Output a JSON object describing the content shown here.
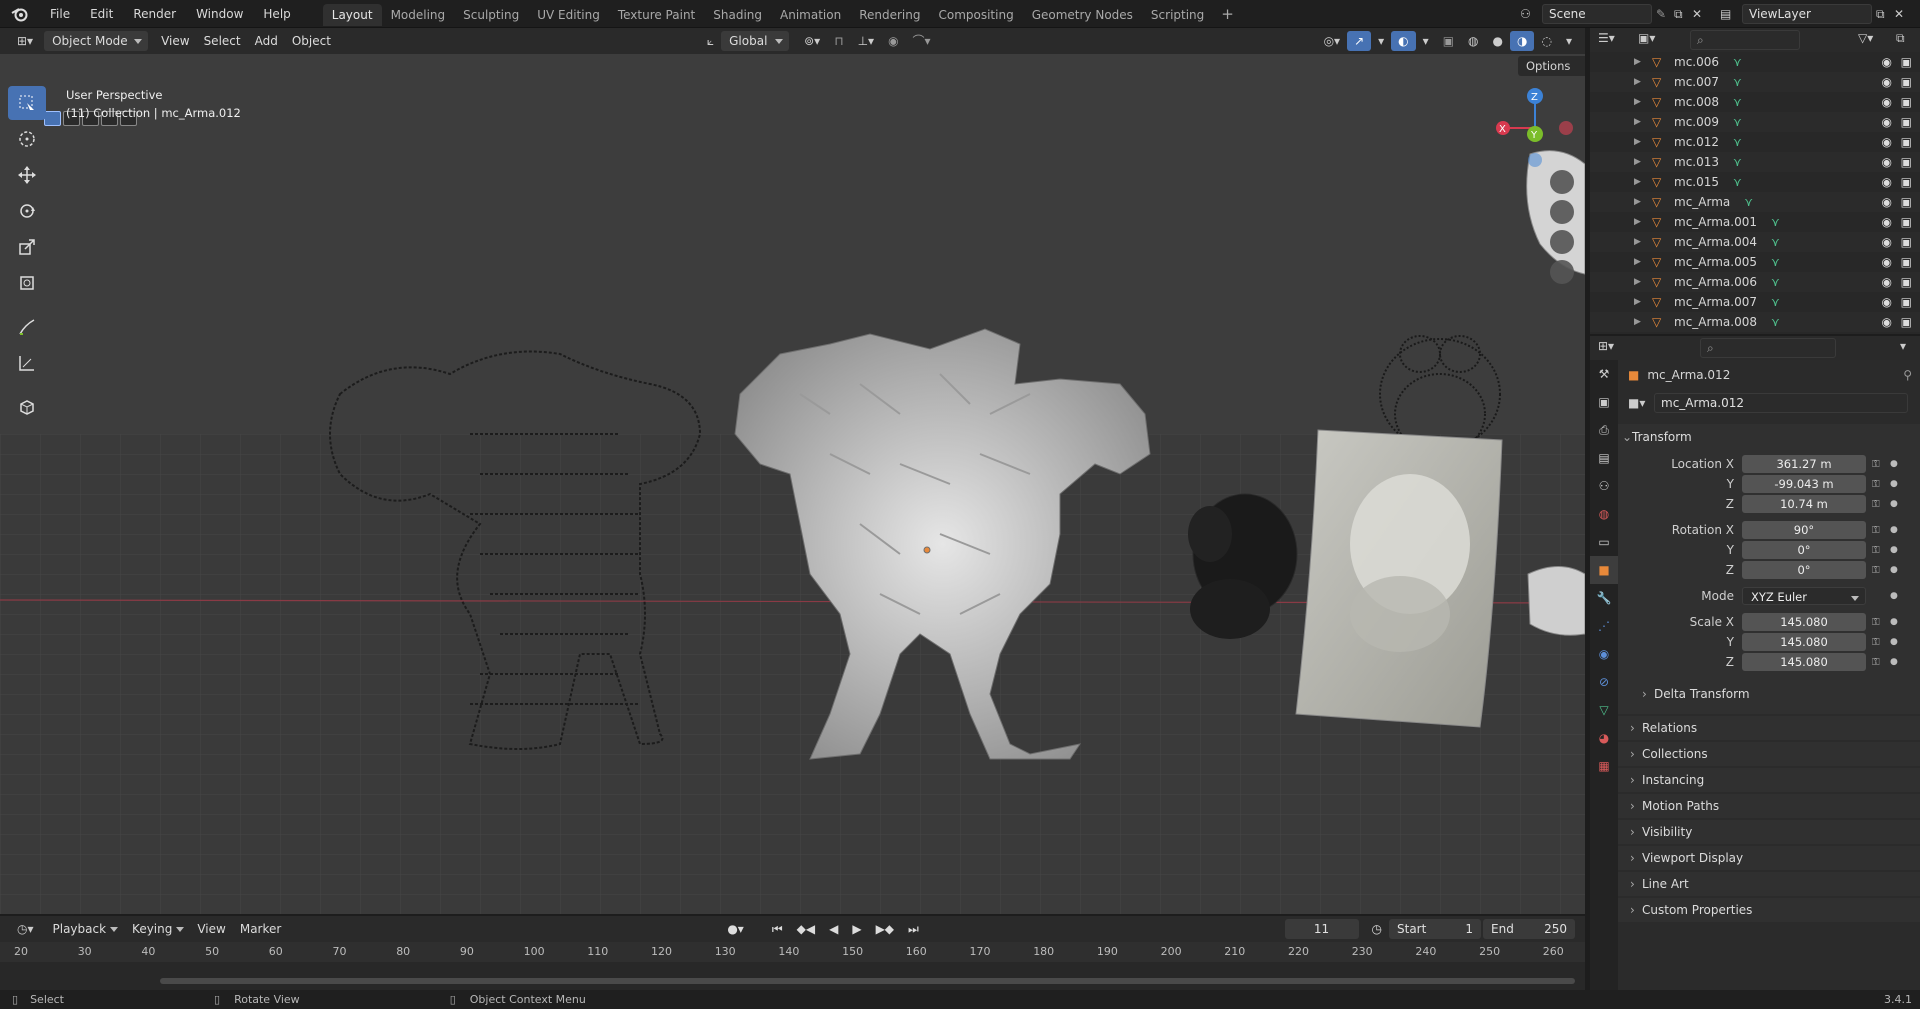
{
  "menubar": {
    "menus": [
      "File",
      "Edit",
      "Render",
      "Window",
      "Help"
    ],
    "workspaces": [
      "Layout",
      "Modeling",
      "Sculpting",
      "UV Editing",
      "Texture Paint",
      "Shading",
      "Animation",
      "Rendering",
      "Compositing",
      "Geometry Nodes",
      "Scripting"
    ],
    "active_workspace": "Layout",
    "scene": "Scene",
    "view_layer": "ViewLayer"
  },
  "viewport_header": {
    "mode": "Object Mode",
    "menus": [
      "View",
      "Select",
      "Add",
      "Object"
    ],
    "orientation": "Global",
    "options_label": "Options"
  },
  "viewport": {
    "perspective_label": "User Perspective",
    "collection_label": "(11) Collection | mc_Arma.012",
    "gizmo_axes": [
      "X",
      "Y",
      "Z"
    ]
  },
  "toolbar": {
    "tools": [
      "select-box-icon",
      "cursor-icon",
      "move-icon",
      "rotate-icon",
      "scale-icon",
      "transform-icon",
      "annotate-icon",
      "measure-icon",
      "add-cube-icon"
    ]
  },
  "outliner": {
    "items": [
      "mc.006",
      "mc.007",
      "mc.008",
      "mc.009",
      "mc.012",
      "mc.013",
      "mc.015",
      "mc_Arma",
      "mc_Arma.001",
      "mc_Arma.004",
      "mc_Arma.005",
      "mc_Arma.006",
      "mc_Arma.007",
      "mc_Arma.008"
    ]
  },
  "properties": {
    "object_name": "mc_Arma.012",
    "object_field": "mc_Arma.012",
    "transform_title": "Transform",
    "location": {
      "label": "Location X",
      "x": "361.27 m",
      "y": "-99.043 m",
      "z": "10.74 m"
    },
    "rotation": {
      "label": "Rotation X",
      "x": "90°",
      "y": "0°",
      "z": "0°"
    },
    "mode_label": "Mode",
    "mode_value": "XYZ Euler",
    "scale": {
      "label": "Scale X",
      "x": "145.080",
      "y": "145.080",
      "z": "145.080"
    },
    "axis_labels": {
      "y": "Y",
      "z": "Z"
    },
    "delta_transform": "Delta Transform",
    "panels": [
      "Relations",
      "Collections",
      "Instancing",
      "Motion Paths",
      "Visibility",
      "Viewport Display",
      "Line Art",
      "Custom Properties"
    ]
  },
  "timeline": {
    "menus": [
      "Playback",
      "Keying",
      "View",
      "Marker"
    ],
    "current_frame": "11",
    "start_label": "Start",
    "start": "1",
    "end_label": "End",
    "end": "250",
    "ticks": [
      "20",
      "30",
      "40",
      "50",
      "60",
      "70",
      "80",
      "90",
      "100",
      "110",
      "120",
      "130",
      "140",
      "150",
      "160",
      "170",
      "180",
      "190",
      "200",
      "210",
      "220",
      "230",
      "240",
      "250",
      "260"
    ]
  },
  "statusbar": {
    "select": "Select",
    "rotate": "Rotate View",
    "context": "Object Context Menu",
    "version": "3.4.1"
  },
  "colors": {
    "accent": "#4772b3",
    "object_orange": "#e8893a",
    "mesh_green": "#4fc08d",
    "axis_x": "#d83a4f",
    "axis_y": "#7bbd2a",
    "axis_z": "#3c82d6"
  }
}
